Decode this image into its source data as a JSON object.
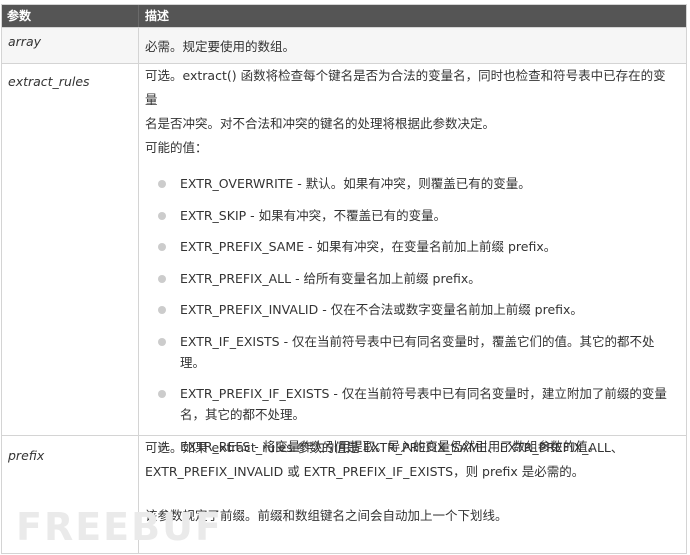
{
  "header": {
    "param": "参数",
    "desc": "描述"
  },
  "rows": {
    "array": {
      "name": "array",
      "desc": "必需。规定要使用的数组。"
    },
    "extract_rules": {
      "name": "extract_rules",
      "desc_line1": "可选。extract() 函数将检查每个键名是否为合法的变量名，同时也检查和符号表中已存在的变量",
      "desc_line2": "名是否冲突。对不合法和冲突的键名的处理将根据此参数决定。",
      "possible": "可能的值：",
      "options": [
        "EXTR_OVERWRITE - 默认。如果有冲突，则覆盖已有的变量。",
        "EXTR_SKIP - 如果有冲突，不覆盖已有的变量。",
        "EXTR_PREFIX_SAME - 如果有冲突，在变量名前加上前缀 prefix。",
        "EXTR_PREFIX_ALL - 给所有变量名加上前缀 prefix。",
        "EXTR_PREFIX_INVALID - 仅在不合法或数字变量名前加上前缀 prefix。",
        "EXTR_IF_EXISTS - 仅在当前符号表中已有同名变量时，覆盖它们的值。其它的都不处理。",
        "EXTR_PREFIX_IF_EXISTS - 仅在当前符号表中已有同名变量时，建立附加了前缀的变量名，其它的都不处理。",
        "EXTR_REFS - 将变量作为引用提取。导入的变量仍然引用了数组参数的值。"
      ]
    },
    "prefix": {
      "name": "prefix",
      "desc_line1": "可选。如果 extract_rules 参数的值是 EXTR_PREFIX_SAME、EXTR_PREFIX_ALL、",
      "desc_line2": "EXTR_PREFIX_INVALID 或 EXTR_PREFIX_IF_EXISTS，则 prefix 是必需的。",
      "desc_line3": "该参数规定了前缀。前缀和数组键名之间会自动加上一个下划线。"
    }
  },
  "watermark": "FREEBUF"
}
